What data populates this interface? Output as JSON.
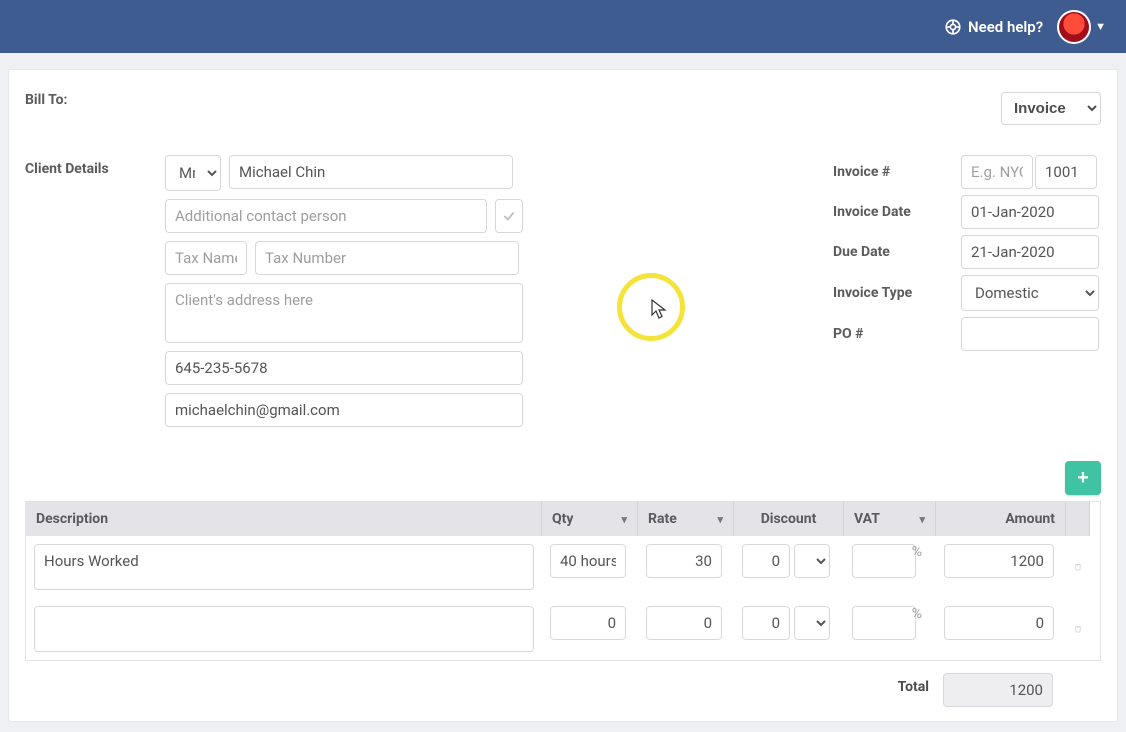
{
  "topbar": {
    "help_label": "Need help?"
  },
  "billto_label": "Bill To:",
  "doc_type": "Invoice",
  "client_details_label": "Client Details",
  "client": {
    "title": "Mr.",
    "name": "Michael Chin",
    "additional_placeholder": "Additional contact person",
    "tax_name_placeholder": "Tax Name",
    "tax_number_placeholder": "Tax Number",
    "address_placeholder": "Client's address here",
    "phone": "645-235-5678",
    "email": "michaelchin@gmail.com"
  },
  "meta": {
    "invoice_num_label": "Invoice #",
    "invoice_num_prefix_placeholder": "E.g. NYC",
    "invoice_num_suffix": "1001",
    "invoice_date_label": "Invoice Date",
    "invoice_date": "01-Jan-2020",
    "due_date_label": "Due Date",
    "due_date": "21-Jan-2020",
    "invoice_type_label": "Invoice Type",
    "invoice_type": "Domestic",
    "po_label": "PO #",
    "po": ""
  },
  "table": {
    "headers": {
      "description": "Description",
      "qty": "Qty",
      "rate": "Rate",
      "discount": "Discount",
      "vat": "VAT",
      "amount": "Amount"
    },
    "rows": [
      {
        "desc": "Hours Worked",
        "qty": "40 hours",
        "rate": "30",
        "discount": "0",
        "disc_unit": "#",
        "vat": "",
        "amount": "1200"
      },
      {
        "desc": "",
        "qty": "0",
        "rate": "0",
        "discount": "0",
        "disc_unit": "#",
        "vat": "",
        "amount": "0"
      }
    ],
    "total_label": "Total",
    "total": "1200"
  }
}
